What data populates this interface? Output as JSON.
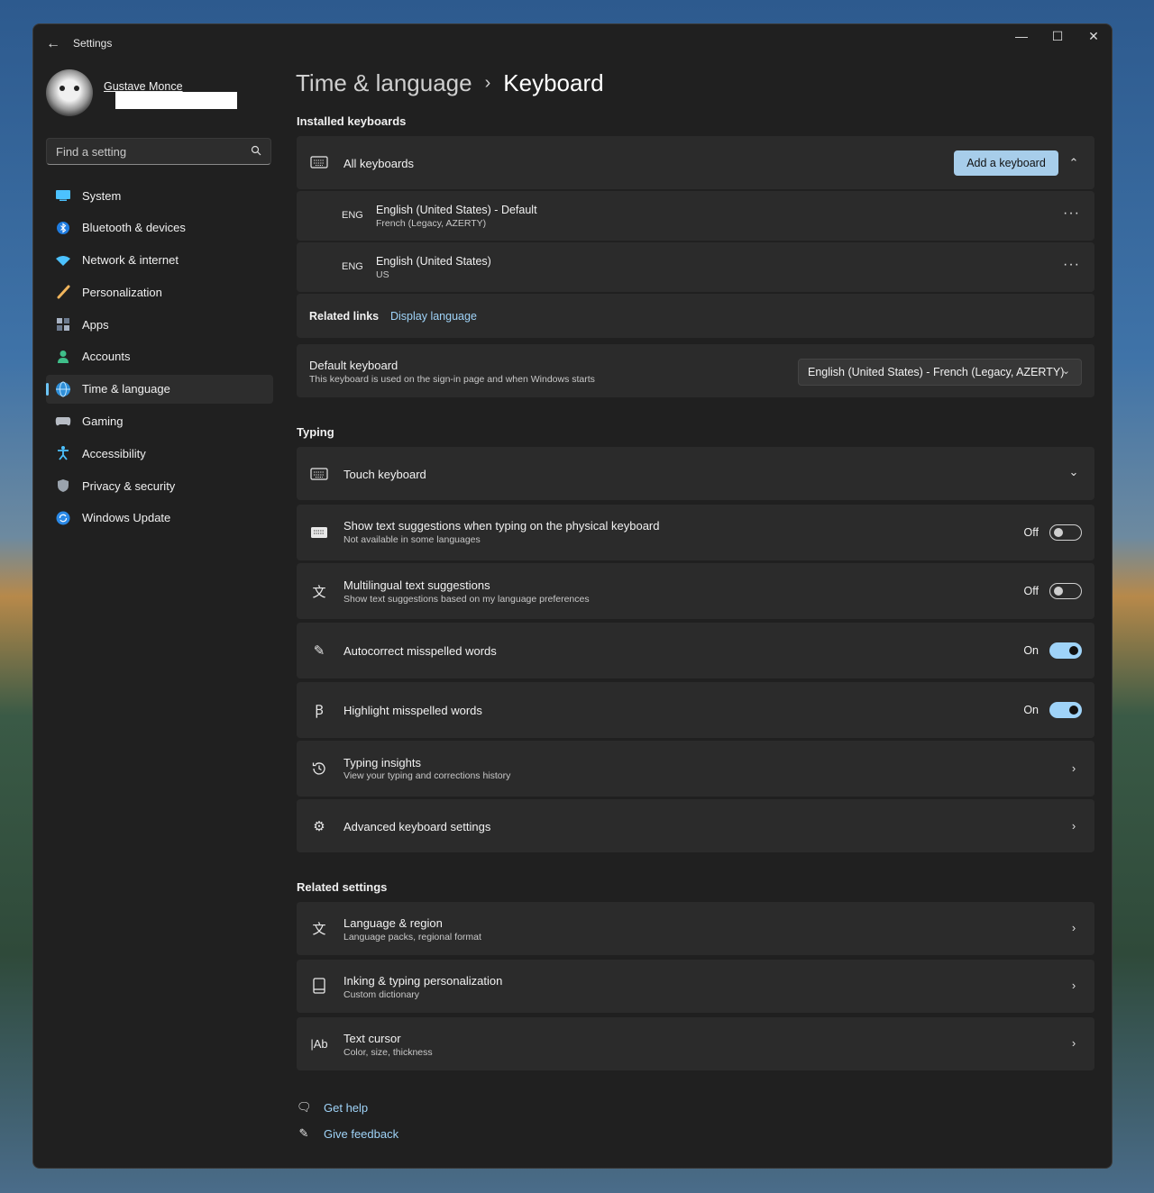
{
  "window": {
    "app_title": "Settings",
    "controls": {
      "minimize": "—",
      "maximize": "☐",
      "close": "✕"
    }
  },
  "profile": {
    "name": "Gustave Monce"
  },
  "search": {
    "placeholder": "Find a setting"
  },
  "sidebar": {
    "items": [
      {
        "label": "System",
        "icon": "system-icon"
      },
      {
        "label": "Bluetooth & devices",
        "icon": "bluetooth-icon"
      },
      {
        "label": "Network & internet",
        "icon": "wifi-icon"
      },
      {
        "label": "Personalization",
        "icon": "brush-icon"
      },
      {
        "label": "Apps",
        "icon": "apps-icon"
      },
      {
        "label": "Accounts",
        "icon": "person-icon"
      },
      {
        "label": "Time & language",
        "icon": "globe-clock-icon",
        "active": true
      },
      {
        "label": "Gaming",
        "icon": "controller-icon"
      },
      {
        "label": "Accessibility",
        "icon": "accessibility-icon"
      },
      {
        "label": "Privacy & security",
        "icon": "shield-icon"
      },
      {
        "label": "Windows Update",
        "icon": "update-icon"
      }
    ]
  },
  "breadcrumb": {
    "parent": "Time & language",
    "separator": "›",
    "current": "Keyboard"
  },
  "installed": {
    "section_title": "Installed keyboards",
    "all_keyboards": "All keyboards",
    "add_button": "Add a keyboard",
    "keyboards": [
      {
        "code": "ENG",
        "title": "English (United States)  - Default",
        "sub": "French (Legacy, AZERTY)"
      },
      {
        "code": "ENG",
        "title": "English (United States)",
        "sub": "US"
      }
    ],
    "related_label": "Related links",
    "related_link": "Display language"
  },
  "default_keyboard": {
    "title": "Default keyboard",
    "sub": "This keyboard is used on the sign-in page and when Windows starts",
    "selected": "English (United States) - French (Legacy, AZERTY)"
  },
  "typing": {
    "section_title": "Typing",
    "touch_keyboard": "Touch keyboard",
    "text_suggestions": {
      "title": "Show text suggestions when typing on the physical keyboard",
      "sub": "Not available in some languages",
      "state": "Off"
    },
    "multilingual": {
      "title": "Multilingual text suggestions",
      "sub": "Show text suggestions based on my language preferences",
      "state": "Off"
    },
    "autocorrect": {
      "title": "Autocorrect misspelled words",
      "state": "On"
    },
    "highlight": {
      "title": "Highlight misspelled words",
      "state": "On"
    },
    "insights": {
      "title": "Typing insights",
      "sub": "View your typing and corrections history"
    },
    "advanced": {
      "title": "Advanced keyboard settings"
    }
  },
  "related_settings": {
    "section_title": "Related settings",
    "items": [
      {
        "title": "Language & region",
        "sub": "Language packs, regional format"
      },
      {
        "title": "Inking & typing personalization",
        "sub": "Custom dictionary"
      },
      {
        "title": "Text cursor",
        "sub": "Color, size, thickness"
      }
    ]
  },
  "footer": {
    "get_help": "Get help",
    "give_feedback": "Give feedback"
  },
  "colors": {
    "accent": "#9fd3f8",
    "button": "#a7cdea",
    "card": "#2b2b2b",
    "window": "#202020"
  }
}
